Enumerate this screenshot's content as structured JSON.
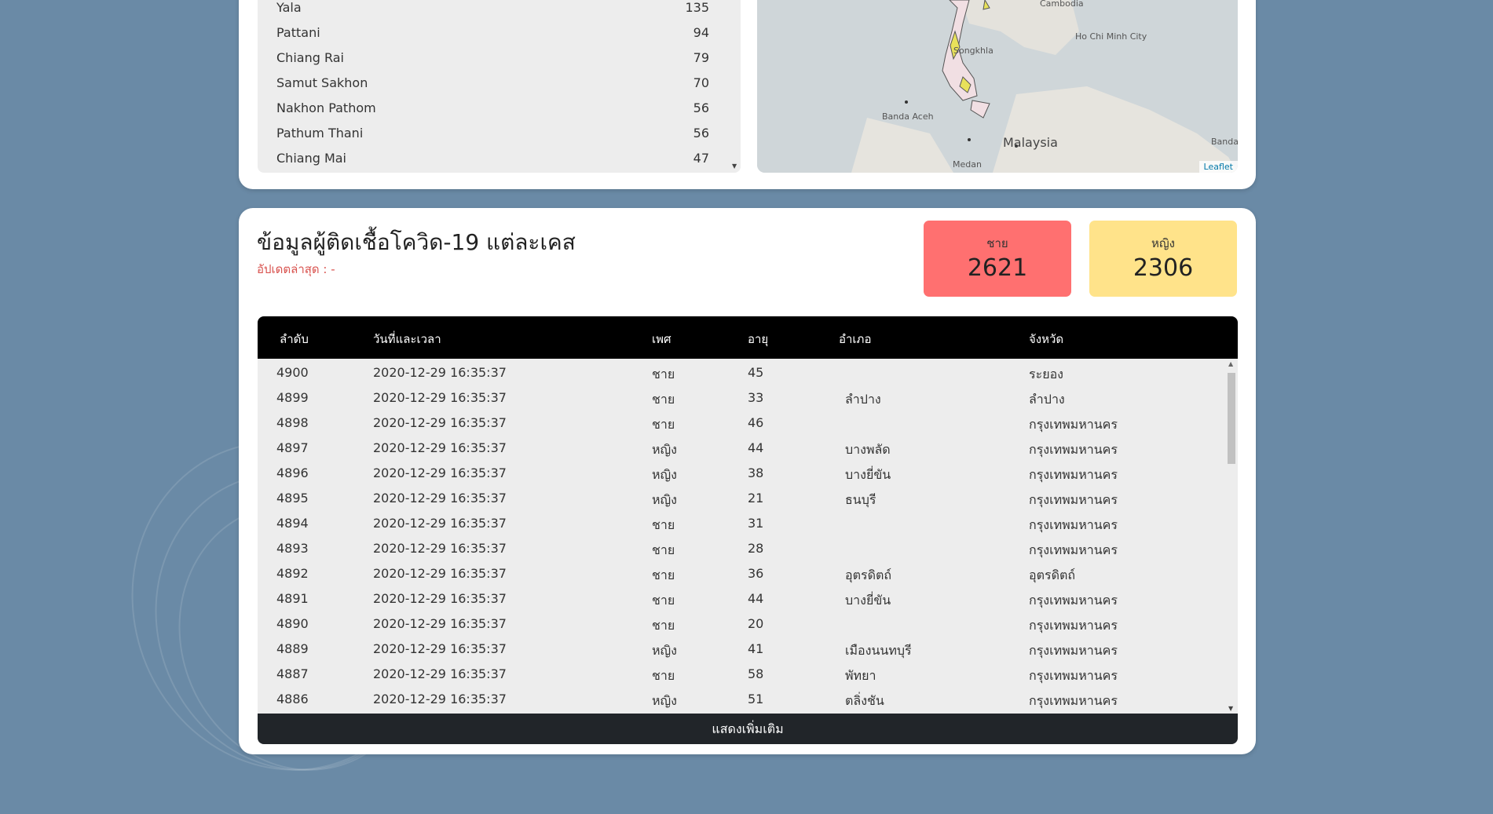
{
  "provinces": [
    {
      "name": "Yala",
      "count": "135"
    },
    {
      "name": "Pattani",
      "count": "94"
    },
    {
      "name": "Chiang Rai",
      "count": "79"
    },
    {
      "name": "Samut Sakhon",
      "count": "70"
    },
    {
      "name": "Nakhon Pathom",
      "count": "56"
    },
    {
      "name": "Pathum Thani",
      "count": "56"
    },
    {
      "name": "Chiang Mai",
      "count": "47"
    }
  ],
  "map": {
    "labels": {
      "cambodia": "Cambodia",
      "hcmc": "Ho Chi Minh City",
      "songkhla": "Songkhla",
      "banda_aceh": "Banda Aceh",
      "malaysia": "Malaysia",
      "medan": "Medan",
      "banda": "Banda"
    },
    "attribution": "Leaflet"
  },
  "cases": {
    "title": "ข้อมูลผู้ติดเชื้อโควิด-19 แต่ละเคส",
    "updated": "อัปเดตล่าสุด : -",
    "male_label": "ชาย",
    "male_count": "2621",
    "female_label": "หญิง",
    "female_count": "2306",
    "headers": [
      "ลำดับ",
      "วันที่และเวลา",
      "เพศ",
      "อายุ",
      "อำเภอ",
      "จังหวัด"
    ],
    "rows": [
      [
        "4900",
        "2020-12-29 16:35:37",
        "ชาย",
        "45",
        "",
        "ระยอง"
      ],
      [
        "4899",
        "2020-12-29 16:35:37",
        "ชาย",
        "33",
        "ลำปาง",
        "ลำปาง"
      ],
      [
        "4898",
        "2020-12-29 16:35:37",
        "ชาย",
        "46",
        "",
        "กรุงเทพมหานคร"
      ],
      [
        "4897",
        "2020-12-29 16:35:37",
        "หญิง",
        "44",
        "บางพลัด",
        "กรุงเทพมหานคร"
      ],
      [
        "4896",
        "2020-12-29 16:35:37",
        "หญิง",
        "38",
        "บางยี่ขัน",
        "กรุงเทพมหานคร"
      ],
      [
        "4895",
        "2020-12-29 16:35:37",
        "หญิง",
        "21",
        "ธนบุรี",
        "กรุงเทพมหานคร"
      ],
      [
        "4894",
        "2020-12-29 16:35:37",
        "ชาย",
        "31",
        "",
        "กรุงเทพมหานคร"
      ],
      [
        "4893",
        "2020-12-29 16:35:37",
        "ชาย",
        "28",
        "",
        "กรุงเทพมหานคร"
      ],
      [
        "4892",
        "2020-12-29 16:35:37",
        "ชาย",
        "36",
        "อุตรดิตถ์",
        "อุตรดิตถ์"
      ],
      [
        "4891",
        "2020-12-29 16:35:37",
        "ชาย",
        "44",
        "บางยี่ขัน",
        "กรุงเทพมหานคร"
      ],
      [
        "4890",
        "2020-12-29 16:35:37",
        "ชาย",
        "20",
        "",
        "กรุงเทพมหานคร"
      ],
      [
        "4889",
        "2020-12-29 16:35:37",
        "หญิง",
        "41",
        "เมืองนนทบุรี",
        "กรุงเทพมหานคร"
      ],
      [
        "4887",
        "2020-12-29 16:35:37",
        "ชาย",
        "58",
        "พัทยา",
        "กรุงเทพมหานคร"
      ],
      [
        "4886",
        "2020-12-29 16:35:37",
        "หญิง",
        "51",
        "ตลิ่งชัน",
        "กรุงเทพมหานคร"
      ]
    ],
    "more_label": "แสดงเพิ่มเติม"
  }
}
